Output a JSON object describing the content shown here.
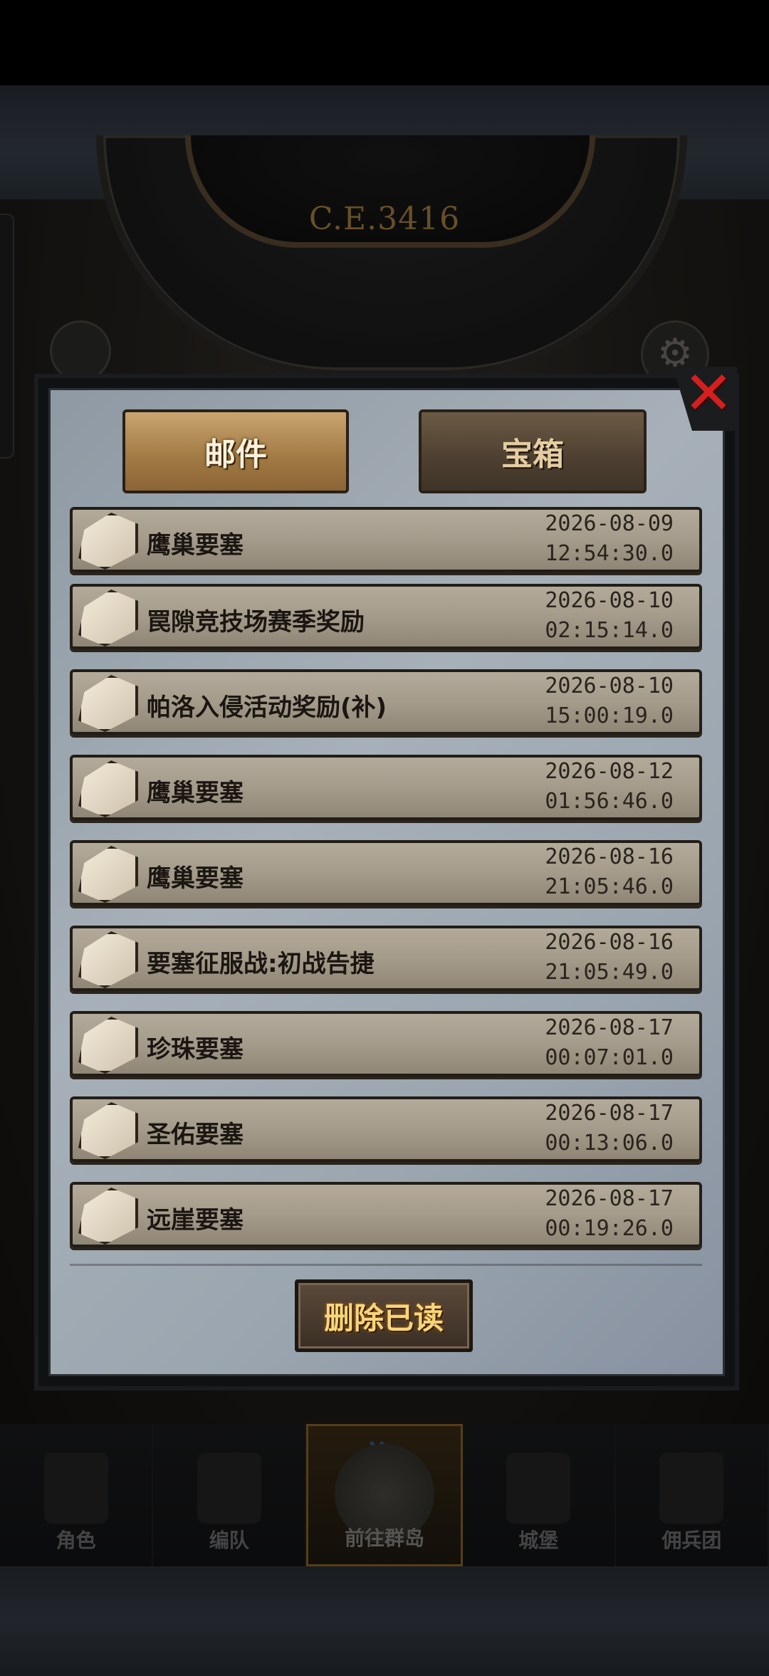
{
  "header": {
    "era_label": "C.E.3416"
  },
  "dialog": {
    "tabs": [
      {
        "label": "邮件",
        "active": true
      },
      {
        "label": "宝箱",
        "active": false
      }
    ],
    "mails": [
      {
        "title": "鹰巢要塞",
        "date": "2026-08-09",
        "time": "12:54:30.0",
        "icon": "chest-icon"
      },
      {
        "title": "罠隙竞技场赛季奖励",
        "date": "2026-08-10",
        "time": "02:15:14.0",
        "icon": "chest-icon"
      },
      {
        "title": "帕洛入侵活动奖励(补)",
        "date": "2026-08-10",
        "time": "15:00:19.0",
        "icon": "chest-icon"
      },
      {
        "title": "鹰巢要塞",
        "date": "2026-08-12",
        "time": "01:56:46.0",
        "icon": "chest-icon"
      },
      {
        "title": "鹰巢要塞",
        "date": "2026-08-16",
        "time": "21:05:46.0",
        "icon": "chest-icon"
      },
      {
        "title": "要塞征服战:初战告捷",
        "date": "2026-08-16",
        "time": "21:05:49.0",
        "icon": "chest-icon"
      },
      {
        "title": "珍珠要塞",
        "date": "2026-08-17",
        "time": "00:07:01.0",
        "icon": "chest-icon"
      },
      {
        "title": "圣佑要塞",
        "date": "2026-08-17",
        "time": "00:13:06.0",
        "icon": "chest-icon"
      },
      {
        "title": "远崖要塞",
        "date": "2026-08-17",
        "time": "00:19:26.0",
        "icon": "chest-icon"
      }
    ],
    "delete_read_label": "删除已读",
    "close_icon": "close-icon",
    "close_color": "#d51f1f"
  },
  "bottom_nav": {
    "items": [
      {
        "label": "角色",
        "active": false
      },
      {
        "label": "编队",
        "active": false
      },
      {
        "label": "前往群岛",
        "active": true
      },
      {
        "label": "城堡",
        "active": false
      },
      {
        "label": "佣兵团",
        "active": false
      }
    ]
  }
}
